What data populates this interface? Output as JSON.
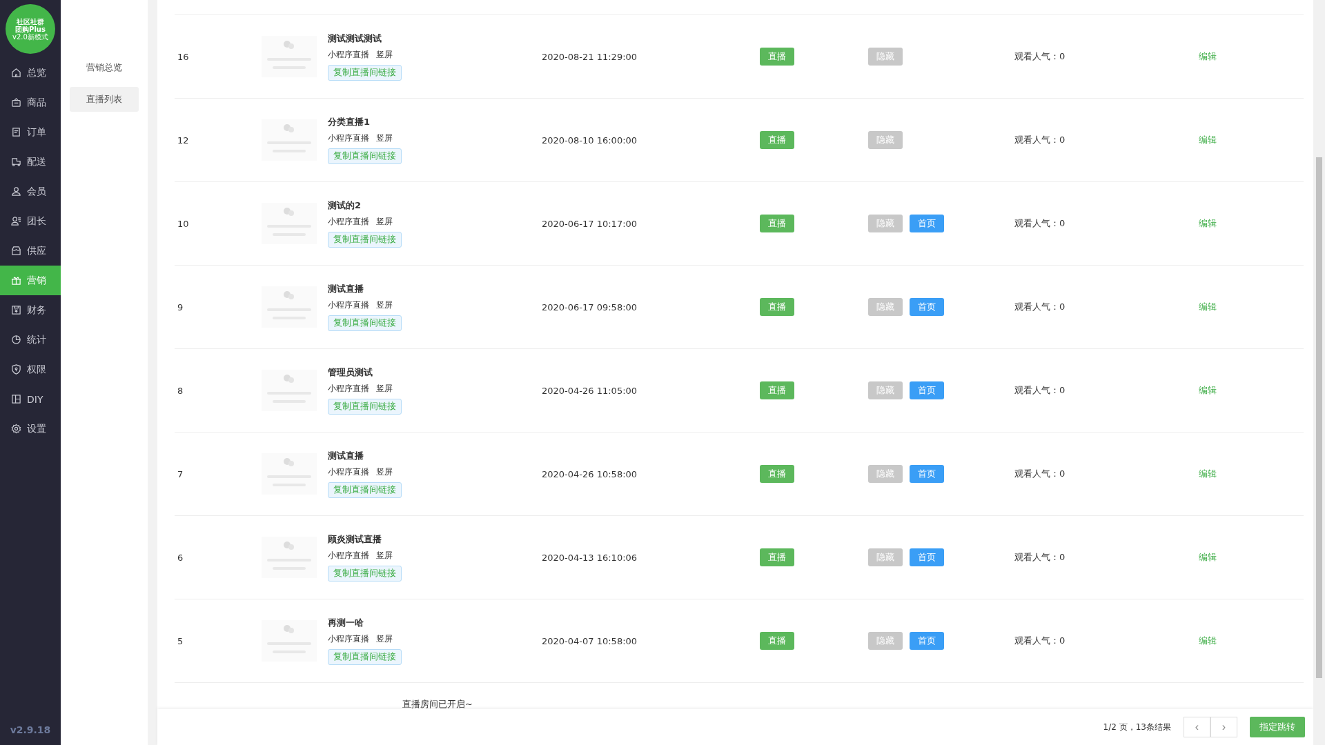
{
  "logo": {
    "line_1": "社区社群",
    "line_2": "团购Plus",
    "line_3": "v2.0新模式"
  },
  "nav": [
    {
      "label": "总览",
      "kind": "home",
      "selected": false
    },
    {
      "label": "商品",
      "kind": "bag",
      "selected": false
    },
    {
      "label": "订单",
      "kind": "order",
      "selected": false
    },
    {
      "label": "配送",
      "kind": "truck",
      "selected": false
    },
    {
      "label": "会员",
      "kind": "user",
      "selected": false
    },
    {
      "label": "团长",
      "kind": "leader",
      "selected": false
    },
    {
      "label": "供应",
      "kind": "store",
      "selected": false
    },
    {
      "label": "营销",
      "kind": "gift",
      "selected": true
    },
    {
      "label": "财务",
      "kind": "money",
      "selected": false
    },
    {
      "label": "统计",
      "kind": "pie",
      "selected": false
    },
    {
      "label": "权限",
      "kind": "shield",
      "selected": false
    },
    {
      "label": "DIY",
      "kind": "layout",
      "selected": false
    },
    {
      "label": "设置",
      "kind": "gear",
      "selected": false
    }
  ],
  "version": "v2.9.18",
  "submenu": [
    {
      "label": "营销总览",
      "selected": false
    },
    {
      "label": "直播列表",
      "selected": true
    }
  ],
  "rows": [
    {
      "id": "16",
      "title": "测试测试测试",
      "type": "小程序直播",
      "orientation": "竖屏",
      "copy_link": "复制直播间链接",
      "time": "2020-08-21 11:29:00",
      "live": "直播",
      "hide": "隐藏",
      "home": null,
      "popularity": "观看人气：0",
      "edit": "编辑"
    },
    {
      "id": "12",
      "title": "分类直播1",
      "type": "小程序直播",
      "orientation": "竖屏",
      "copy_link": "复制直播间链接",
      "time": "2020-08-10 16:00:00",
      "live": "直播",
      "hide": "隐藏",
      "home": null,
      "popularity": "观看人气：0",
      "edit": "编辑"
    },
    {
      "id": "10",
      "title": "测试的2",
      "type": "小程序直播",
      "orientation": "竖屏",
      "copy_link": "复制直播间链接",
      "time": "2020-06-17 10:17:00",
      "live": "直播",
      "hide": "隐藏",
      "home": "首页",
      "popularity": "观看人气：0",
      "edit": "编辑"
    },
    {
      "id": "9",
      "title": "测试直播",
      "type": "小程序直播",
      "orientation": "竖屏",
      "copy_link": "复制直播间链接",
      "time": "2020-06-17 09:58:00",
      "live": "直播",
      "hide": "隐藏",
      "home": "首页",
      "popularity": "观看人气：0",
      "edit": "编辑"
    },
    {
      "id": "8",
      "title": "管理员测试",
      "type": "小程序直播",
      "orientation": "竖屏",
      "copy_link": "复制直播间链接",
      "time": "2020-04-26 11:05:00",
      "live": "直播",
      "hide": "隐藏",
      "home": "首页",
      "popularity": "观看人气：0",
      "edit": "编辑"
    },
    {
      "id": "7",
      "title": "测试直播",
      "type": "小程序直播",
      "orientation": "竖屏",
      "copy_link": "复制直播间链接",
      "time": "2020-04-26 10:58:00",
      "live": "直播",
      "hide": "隐藏",
      "home": "首页",
      "popularity": "观看人气：0",
      "edit": "编辑"
    },
    {
      "id": "6",
      "title": "顾炎测试直播",
      "type": "小程序直播",
      "orientation": "竖屏",
      "copy_link": "复制直播间链接",
      "time": "2020-04-13 16:10:06",
      "live": "直播",
      "hide": "隐藏",
      "home": "首页",
      "popularity": "观看人气：0",
      "edit": "编辑"
    },
    {
      "id": "5",
      "title": "再测一哈",
      "type": "小程序直播",
      "orientation": "竖屏",
      "copy_link": "复制直播间链接",
      "time": "2020-04-07 10:58:00",
      "live": "直播",
      "hide": "隐藏",
      "home": "首页",
      "popularity": "观看人气：0",
      "edit": "编辑"
    }
  ],
  "partial_row": {
    "title": "直播房间已开启~"
  },
  "footer": {
    "summary": "1/2 页，13条结果",
    "prev": "‹",
    "next": "›",
    "jump": "指定跳转"
  }
}
